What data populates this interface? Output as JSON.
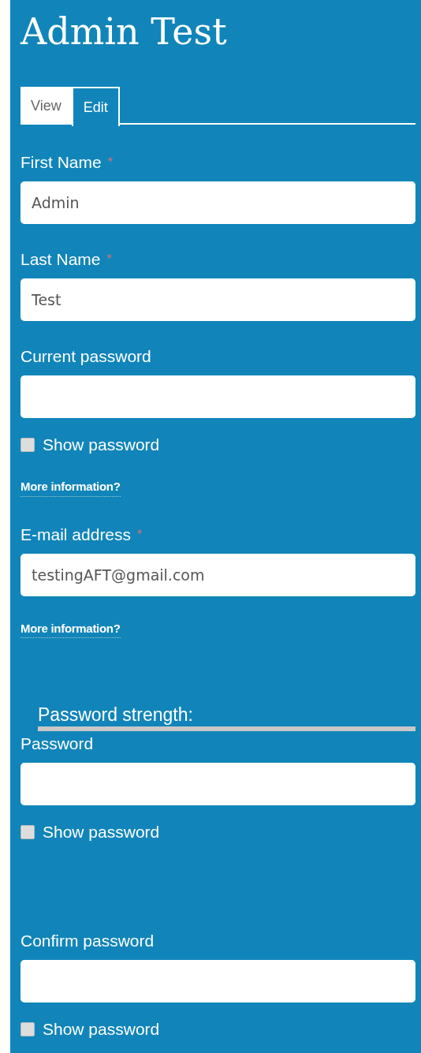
{
  "title": "Admin Test",
  "tabs": [
    {
      "label": "View",
      "selected": false
    },
    {
      "label": "Edit",
      "selected": true
    }
  ],
  "sections": [
    {
      "items": [
        {
          "kind": "field",
          "label": "First Name",
          "required_mark": "*",
          "value": "Admin"
        },
        {
          "kind": "field",
          "label": "Last Name",
          "required_mark": "*",
          "value": "Test"
        },
        {
          "kind": "field",
          "label": "Current password"
        },
        {
          "kind": "checkbox",
          "label": "Show password",
          "checked": false
        },
        {
          "kind": "link",
          "label": "More information?"
        }
      ]
    },
    {
      "items": [
        {
          "kind": "field",
          "label": "E-mail address",
          "required_mark": "*",
          "value": "testingAFT@gmail.com"
        },
        {
          "kind": "link",
          "label": "More information?"
        }
      ]
    },
    {
      "items": [
        {
          "kind": "strength",
          "label": "Password strength:"
        },
        {
          "kind": "field",
          "label": "Password"
        },
        {
          "kind": "checkbox",
          "label": "Show password",
          "checked": false
        }
      ]
    },
    {
      "items": [
        {
          "kind": "field",
          "label": "Confirm password"
        },
        {
          "kind": "checkbox",
          "label": "Show password",
          "checked": false
        }
      ]
    }
  ]
}
